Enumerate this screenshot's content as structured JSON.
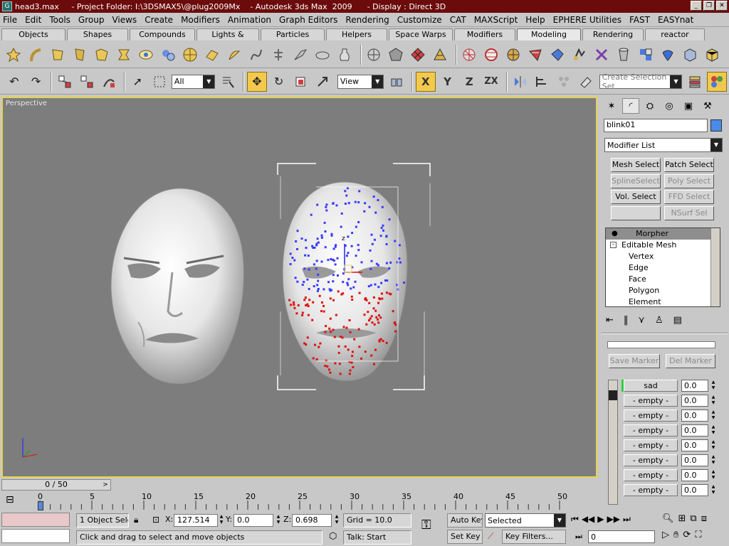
{
  "titlebar": {
    "title": "head3.max     - Project Folder: I:\\3DSMAX5\\@plug2009Mx    - Autodesk 3ds Max  2009      - Display : Direct 3D"
  },
  "menu": [
    "File",
    "Edit",
    "Tools",
    "Group",
    "Views",
    "Create",
    "Modifiers",
    "Animation",
    "Graph Editors",
    "Rendering",
    "Customize",
    "CAT",
    "MAXScript",
    "Help",
    "EPHERE Utilities",
    "FAST",
    "EASYnat"
  ],
  "tabs": [
    "Objects",
    "Shapes",
    "Compounds",
    "Lights & Cameras",
    "Particles",
    "Helpers",
    "Space Warps",
    "Modifiers",
    "Modeling",
    "Rendering",
    "reactor"
  ],
  "active_tab": "Modeling",
  "toolbar": {
    "selection_filter": "All",
    "reference_coord": "View",
    "named_selection_placeholder": "Create Selection Set",
    "axis_x": "X",
    "axis_y": "Y",
    "axis_z": "Z",
    "axis_zx": "ZX"
  },
  "viewport": {
    "label": "Perspective",
    "gizmo_label": "z"
  },
  "command_panel": {
    "object_name": "blink01",
    "modifier_list": "Modifier List",
    "buttons": [
      {
        "label": "Mesh Select",
        "enabled": true
      },
      {
        "label": "Patch Select",
        "enabled": true
      },
      {
        "label": "SplineSelect",
        "enabled": false
      },
      {
        "label": "Poly Select",
        "enabled": false
      },
      {
        "label": "Vol. Select",
        "enabled": true
      },
      {
        "label": "FFD Select",
        "enabled": false
      },
      {
        "label": "",
        "enabled": false
      },
      {
        "label": "NSurf Sel",
        "enabled": false
      }
    ],
    "stack": [
      {
        "label": "Morpher",
        "level": 0,
        "selected": true
      },
      {
        "label": "Editable Mesh",
        "level": 0,
        "selected": false
      },
      {
        "label": "Vertex",
        "level": 1,
        "selected": false
      },
      {
        "label": "Edge",
        "level": 1,
        "selected": false
      },
      {
        "label": "Face",
        "level": 1,
        "selected": false
      },
      {
        "label": "Polygon",
        "level": 1,
        "selected": false
      },
      {
        "label": "Element",
        "level": 1,
        "selected": false
      }
    ],
    "save_marker": "Save Marker",
    "del_marker": "Del Marker",
    "channels": [
      {
        "name": "sad",
        "value": "0.0"
      },
      {
        "name": "- empty -",
        "value": "0.0"
      },
      {
        "name": "- empty -",
        "value": "0.0"
      },
      {
        "name": "- empty -",
        "value": "0.0"
      },
      {
        "name": "- empty -",
        "value": "0.0"
      },
      {
        "name": "- empty -",
        "value": "0.0"
      },
      {
        "name": "- empty -",
        "value": "0.0"
      },
      {
        "name": "- empty -",
        "value": "0.0"
      }
    ]
  },
  "timeline": {
    "slider": "0 / 50",
    "ticks": [
      "0",
      "5",
      "10",
      "15",
      "20",
      "25",
      "30",
      "35",
      "40",
      "45",
      "50"
    ]
  },
  "status": {
    "selection": "1 Object Sele",
    "x_label": "X:",
    "x_value": "127.514",
    "y_label": "Y:",
    "y_value": "0.0",
    "z_label": "Z:",
    "z_value": "0.698",
    "grid": "Grid = 10.0",
    "prompt": "Click and drag to select and move objects",
    "talk": "Talk: Start",
    "auto_key": "Auto Key",
    "set_key": "Set Key",
    "key_mode": "Selected",
    "key_filters": "Key Filters...",
    "frame": "0"
  },
  "colors": {
    "title_bg": "#6b0b0b",
    "viewport_bg": "#7d7d7d",
    "active_border": "#e8d44d",
    "vertex_blue": "#3a3aff",
    "vertex_red": "#e01010"
  }
}
